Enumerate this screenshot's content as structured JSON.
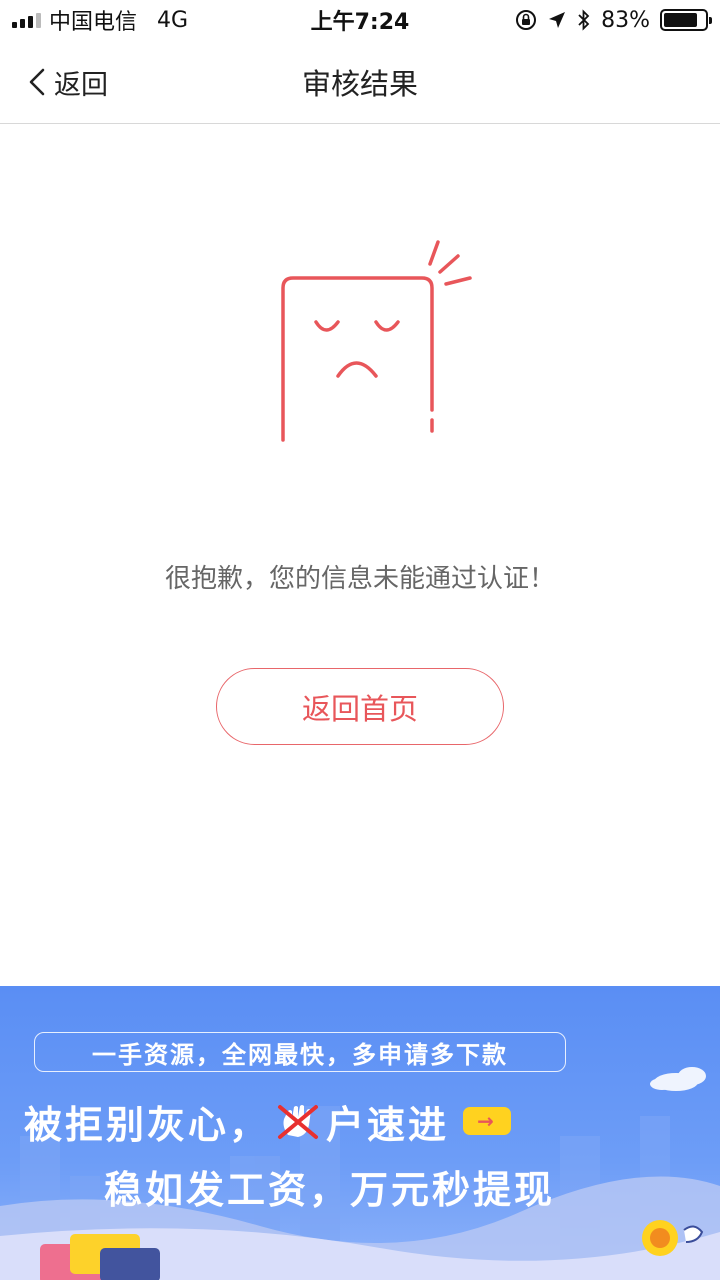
{
  "status_bar": {
    "carrier": "中国电信",
    "network": "4G",
    "time": "上午7:24",
    "battery": "83%",
    "battery_level": 0.83
  },
  "nav": {
    "back_label": "返回",
    "title": "审核结果"
  },
  "result": {
    "message": "很抱歉，您的信息未能通过认证！",
    "home_button_label": "返回首页",
    "icon": "sad-document-icon",
    "accent_color": "#e8565a"
  },
  "banner": {
    "tagline": "一手资源，全网最快，多申请多下款",
    "line1_before": "被拒别灰心，",
    "line1_after": "户速进",
    "line2": "稳如发工资，万元秒提现"
  }
}
